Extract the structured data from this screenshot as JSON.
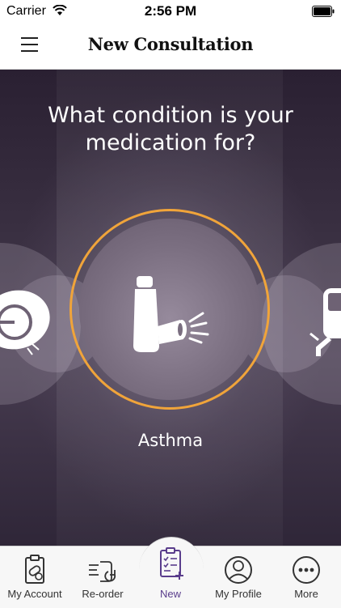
{
  "status_bar": {
    "carrier": "Carrier",
    "time": "2:56 PM"
  },
  "nav": {
    "title": "New Consultation"
  },
  "main": {
    "question_line1": "What condition is your",
    "question_line2": "medication for?",
    "selected_condition": "Asthma",
    "accent_color": "#f0a43a"
  },
  "tabs": [
    {
      "label": "My Account",
      "icon": "clipboard-pill-icon"
    },
    {
      "label": "Re-order",
      "icon": "reorder-icon"
    },
    {
      "label": "New",
      "icon": "new-consultation-icon",
      "active": true
    },
    {
      "label": "My Profile",
      "icon": "profile-icon"
    },
    {
      "label": "More",
      "icon": "more-icon"
    }
  ],
  "colors": {
    "active_tab": "#5a3d8c"
  }
}
